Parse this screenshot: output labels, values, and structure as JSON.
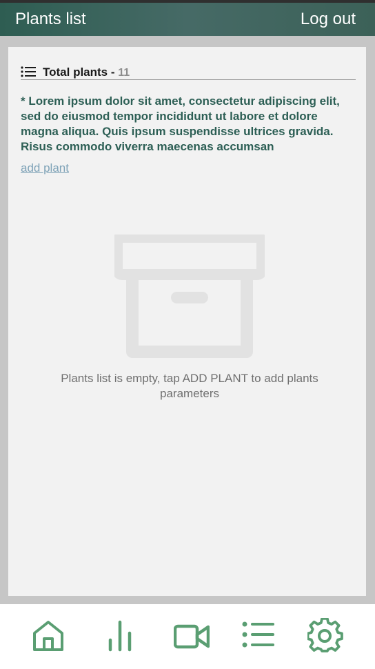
{
  "header": {
    "title": "Plants list",
    "logout_label": "Log out"
  },
  "summary": {
    "label": "Total plants",
    "separator": " - ",
    "count": "11"
  },
  "description": "* Lorem ipsum dolor sit amet, consectetur adipiscing elit, sed do eiusmod tempor incididunt ut labore et dolore magna aliqua. Quis ipsum suspendisse ultrices gravida. Risus commodo viverra maecenas accumsan",
  "add_plant_label": "add plant",
  "empty_state": {
    "icon": "archive-box-icon",
    "message": "Plants list is empty, tap ADD PLANT to add plants parameters"
  },
  "bottom_nav": {
    "items": [
      {
        "icon": "home-icon"
      },
      {
        "icon": "bar-chart-icon"
      },
      {
        "icon": "video-camera-icon"
      },
      {
        "icon": "list-icon"
      },
      {
        "icon": "gear-icon"
      }
    ]
  },
  "colors": {
    "header_bg": "#3e6560",
    "accent_text": "#2d5f55",
    "nav_icon": "#5a9e72",
    "link": "#7fa3b8"
  }
}
